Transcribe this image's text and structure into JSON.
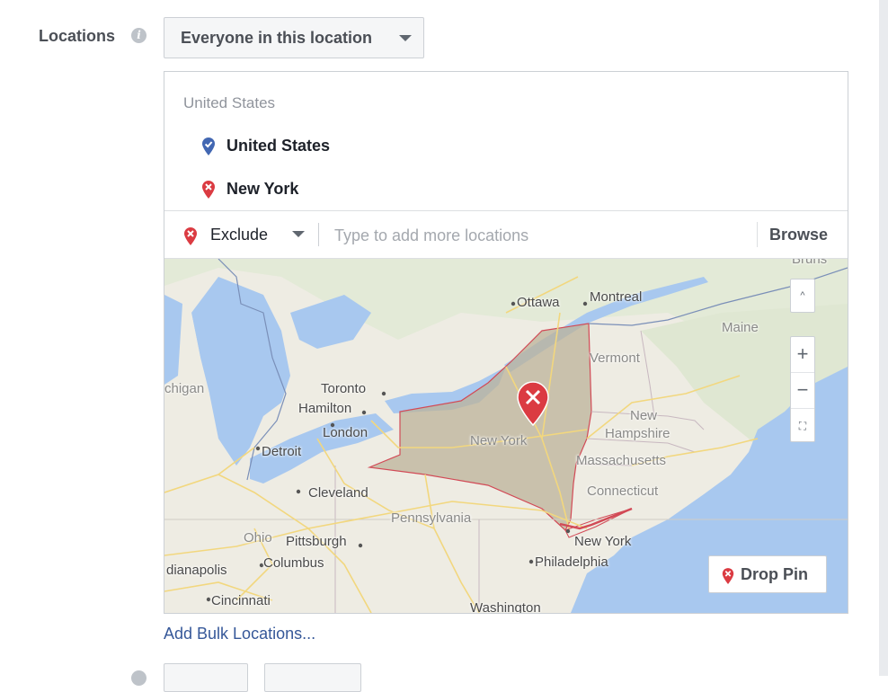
{
  "locations": {
    "label": "Locations",
    "info_glyph": "i",
    "mode_dropdown": "Everyone in this location",
    "group_title": "United States",
    "items": [
      {
        "label": "United States",
        "icon": "blue-pin-icon",
        "color": "#4267b2"
      },
      {
        "label": "New York",
        "icon": "red-exclude-pin-icon",
        "color": "#db3b42"
      }
    ],
    "exclude_label": "Exclude",
    "search_placeholder": "Type to add more locations",
    "browse_label": "Browse",
    "bulk_link": "Add Bulk Locations..."
  },
  "map": {
    "labels": {
      "ottawa": "Ottawa",
      "montreal": "Montreal",
      "maine": "Maine",
      "vermont": "Vermont",
      "new_hampshire_1": "New",
      "new_hampshire_2": "Hampshire",
      "massachusetts": "Massachusetts",
      "connecticut": "Connecticut",
      "new_york_state": "New York",
      "new_york_city": "New York",
      "philadelphia": "Philadelphia",
      "pennsylvania": "Pennsylvania",
      "toronto": "Toronto",
      "hamilton": "Hamilton",
      "london": "London",
      "detroit": "Detroit",
      "cleveland": "Cleveland",
      "pittsburgh": "Pittsburgh",
      "columbus": "Columbus",
      "ohio": "Ohio",
      "indianapolis": "dianapolis",
      "cincinnati": "Cincinnati",
      "washington": "Washington",
      "michigan": "chigan",
      "bruns": "Bruns"
    },
    "controls": {
      "up": "^",
      "zoom_in": "+",
      "zoom_out": "−",
      "fullscreen": "⛶"
    },
    "drop_pin_label": "Drop Pin",
    "colors": {
      "land": "#f1efe6",
      "water": "#a8c8ef",
      "selected_region": "#bcb39a",
      "region_border": "#d24a56",
      "pin": "#db3b42"
    }
  }
}
